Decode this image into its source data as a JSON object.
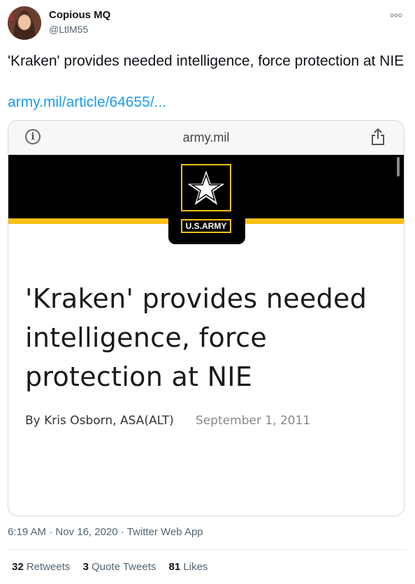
{
  "author": {
    "name": "Copious MQ",
    "handle": "@LtlM55"
  },
  "more_icon": "more-options-icon",
  "tweet": {
    "text": "'Kraken' provides needed intelligence, force protection at NIE",
    "link_text": "army.mil/article/64655/..."
  },
  "card": {
    "domain": "army.mil",
    "logo_text": "U.S.ARMY",
    "headline": "'Kraken' provides needed intelligence, force protection at NIE",
    "byline": "By Kris Osborn, ASA(ALT)",
    "date": "September 1, 2011",
    "colors": {
      "banner": "#000000",
      "stripe": "#fbbf16"
    }
  },
  "meta": {
    "time": "6:19 AM",
    "date": "Nov 16, 2020",
    "source": "Twitter Web App",
    "separator": "·"
  },
  "stats": {
    "retweets_count": "32",
    "retweets_label": "Retweets",
    "quotes_count": "3",
    "quotes_label": "Quote Tweets",
    "likes_count": "81",
    "likes_label": "Likes"
  }
}
